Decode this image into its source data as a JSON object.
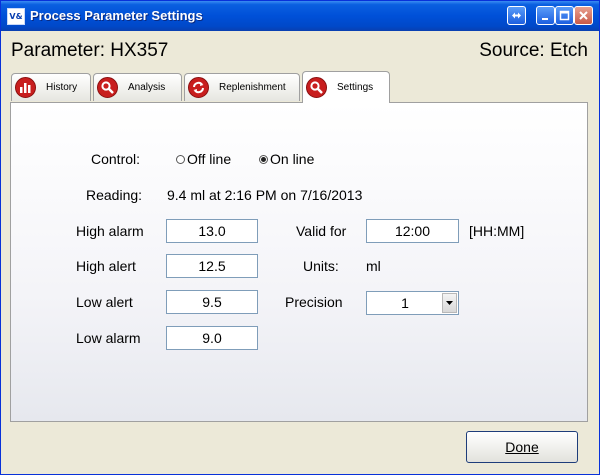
{
  "window": {
    "title": "Process Parameter Settings",
    "app_icon_text": "V&"
  },
  "header": {
    "parameter": "Parameter: HX357",
    "source": "Source: Etch"
  },
  "tabs": [
    {
      "label": "History",
      "icon": "bar-chart-icon"
    },
    {
      "label": "Analysis",
      "icon": "magnifier-icon"
    },
    {
      "label": "Replenishment",
      "icon": "refresh-icon"
    },
    {
      "label": "Settings",
      "icon": "magnifier-icon",
      "active": true
    }
  ],
  "settings": {
    "control_label": "Control:",
    "off_line_label": "Off line",
    "on_line_label": "On line",
    "control_selected": "On line",
    "reading_label": "Reading:",
    "reading_value": "9.4 ml at 2:16 PM on 7/16/2013",
    "high_alarm_label": "High alarm",
    "high_alarm_value": "13.0",
    "high_alert_label": "High alert",
    "high_alert_value": "12.5",
    "low_alert_label": "Low alert",
    "low_alert_value": "9.5",
    "low_alarm_label": "Low alarm",
    "low_alarm_value": "9.0",
    "valid_for_label": "Valid for",
    "valid_for_value": "12:00",
    "valid_for_format": "[HH:MM]",
    "units_label": "Units:",
    "units_value": "ml",
    "precision_label": "Precision",
    "precision_value": "1"
  },
  "buttons": {
    "done": "Done"
  },
  "colors": {
    "titlebar": "#0050d8",
    "tab_icon": "#c81e1e",
    "window_bg": "#ece9d8"
  }
}
